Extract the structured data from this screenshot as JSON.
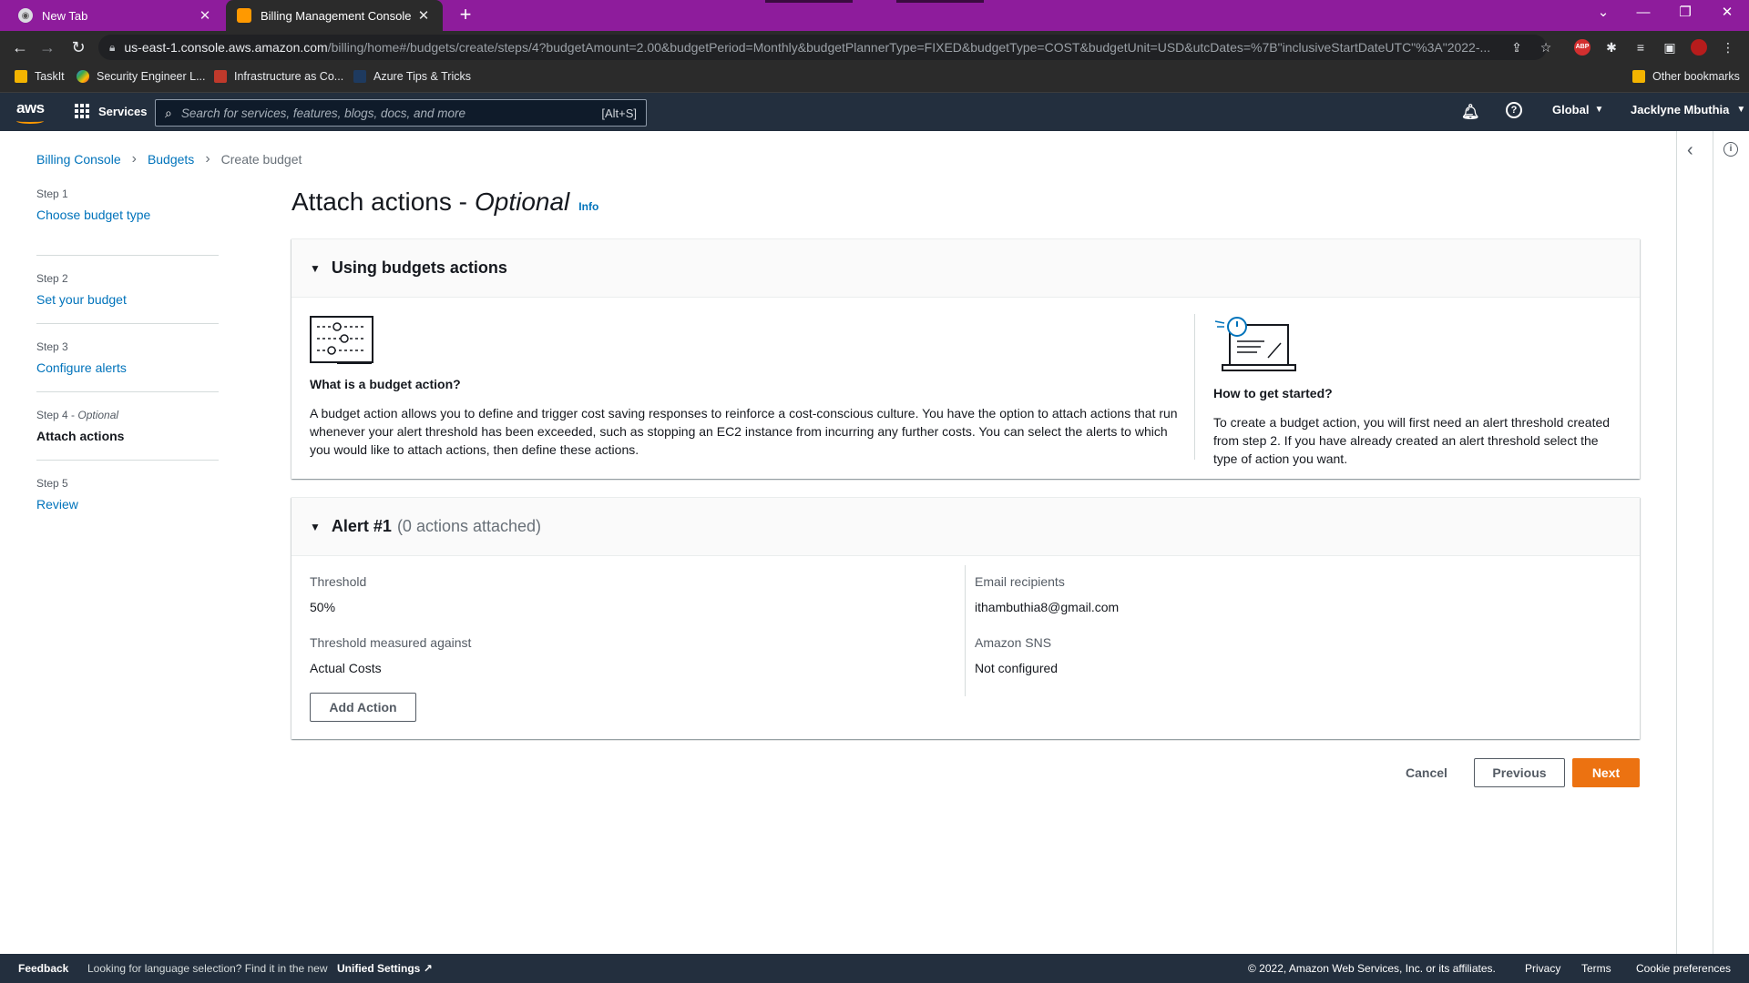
{
  "browser": {
    "tabs": [
      {
        "title": "New Tab"
      },
      {
        "title": "Billing Management Console"
      }
    ],
    "url_host": "us-east-1.console.aws.amazon.com",
    "url_path": "/billing/home#/budgets/create/steps/4?budgetAmount=2.00&budgetPeriod=Monthly&budgetPlannerType=FIXED&budgetType=COST&budgetUnit=USD&utcDates=%7B\"inclusiveStartDateUTC\"%3A\"2022-...",
    "bookmarks": [
      "TaskIt",
      "Security Engineer L...",
      "Infrastructure as Co...",
      "Azure Tips  & Tricks"
    ],
    "other_bookmarks": "Other bookmarks",
    "abp_badge": "ABP"
  },
  "aws_header": {
    "logo": "aws",
    "services_label": "Services",
    "search_placeholder": "Search for services, features, blogs, docs, and more",
    "search_shortcut": "[Alt+S]",
    "region": "Global",
    "user": "Jacklyne Mbuthia"
  },
  "breadcrumb": {
    "items": [
      "Billing Console",
      "Budgets"
    ],
    "current": "Create budget"
  },
  "steps": [
    {
      "label": "Step 1",
      "name": "Choose budget type"
    },
    {
      "label": "Step 2",
      "name": "Set your budget"
    },
    {
      "label": "Step 3",
      "name": "Configure alerts"
    },
    {
      "label": "Step 4",
      "label_suffix": "Optional",
      "name": "Attach actions"
    },
    {
      "label": "Step 5",
      "name": "Review"
    }
  ],
  "page": {
    "title": "Attach actions -",
    "title_italic": "Optional",
    "info": "Info"
  },
  "using_panel": {
    "heading": "Using budgets actions",
    "left_title": "What is a budget action?",
    "left_text": "A budget action allows you to define and trigger cost saving responses to reinforce a cost-conscious culture. You have the option to attach actions that run whenever your alert threshold has been exceeded, such as stopping an EC2 instance from incurring any further costs. You can select the alerts to which you would like to attach actions, then define these actions.",
    "right_title": "How to get started?",
    "right_text": "To create a budget action, you will first need an alert threshold created from step 2. If you have already created an alert threshold select the type of action you want."
  },
  "alert_panel": {
    "heading": "Alert #1",
    "sub": "(0 actions attached)",
    "threshold_label": "Threshold",
    "threshold_value": "50%",
    "measured_label": "Threshold measured against",
    "measured_value": "Actual Costs",
    "email_label": "Email recipients",
    "email_value": "ithambuthia8@gmail.com",
    "sns_label": "Amazon SNS",
    "sns_value": "Not configured",
    "add_action": "Add Action"
  },
  "actions": {
    "cancel": "Cancel",
    "previous": "Previous",
    "next": "Next"
  },
  "footer": {
    "feedback": "Feedback",
    "lang_note": "Looking for language selection? Find it in the new",
    "unified": "Unified Settings",
    "copyright": "© 2022, Amazon Web Services, Inc. or its affiliates.",
    "privacy": "Privacy",
    "terms": "Terms",
    "cookies": "Cookie preferences"
  },
  "colors": {
    "tabstrip": "#8e1c9c",
    "aws_nav": "#232f3e",
    "link": "#0073bb",
    "primary_button": "#ec7211"
  }
}
